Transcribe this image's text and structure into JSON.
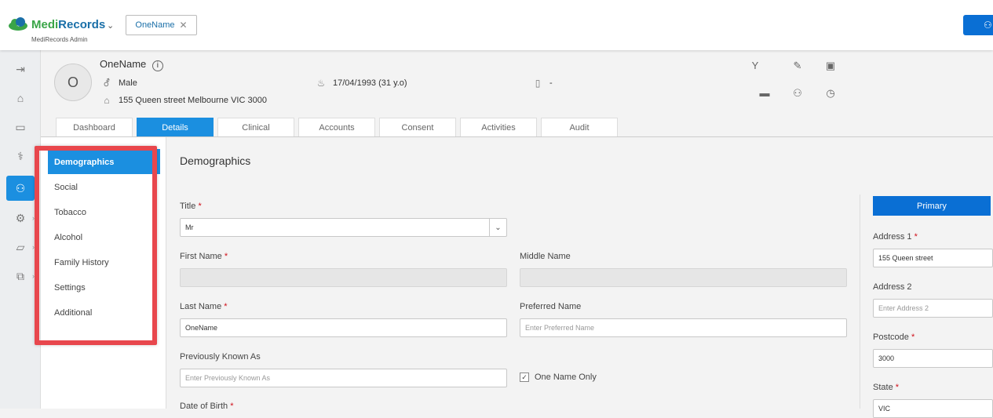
{
  "app": {
    "brand_part1": "Medi",
    "brand_part2": "Records",
    "brand_sub": "MediRecords Admin",
    "open_tab": "OneName"
  },
  "patient": {
    "name": "OneName",
    "avatar_initial": "O",
    "gender": "Male",
    "address": "155 Queen street Melbourne VIC 3000",
    "dob": "17/04/1993 (31 y.o)",
    "phone": "-"
  },
  "tabs": [
    {
      "label": "Dashboard"
    },
    {
      "label": "Details"
    },
    {
      "label": "Clinical"
    },
    {
      "label": "Accounts"
    },
    {
      "label": "Consent"
    },
    {
      "label": "Activities"
    },
    {
      "label": "Audit"
    }
  ],
  "side_menu": [
    {
      "label": "Demographics"
    },
    {
      "label": "Social"
    },
    {
      "label": "Tobacco"
    },
    {
      "label": "Alcohol"
    },
    {
      "label": "Family History"
    },
    {
      "label": "Settings"
    },
    {
      "label": "Additional"
    }
  ],
  "form": {
    "title": "Demographics",
    "title_label": "Title",
    "title_value": "Mr",
    "first_name_label": "First Name",
    "middle_name_label": "Middle Name",
    "last_name_label": "Last Name",
    "last_name_value": "OneName",
    "preferred_name_label": "Preferred Name",
    "preferred_name_placeholder": "Enter Preferred Name",
    "prev_known_label": "Previously Known As",
    "prev_known_placeholder": "Enter Previously Known As",
    "one_name_only_label": "One Name Only",
    "dob_label": "Date of Birth",
    "required_mark": "*"
  },
  "address": {
    "tab_label": "Primary",
    "address1_label": "Address 1",
    "address1_value": "155 Queen street",
    "address2_label": "Address 2",
    "address2_placeholder": "Enter Address 2",
    "postcode_label": "Postcode",
    "postcode_value": "3000",
    "state_label": "State",
    "state_value": "VIC"
  },
  "colors": {
    "accent": "#1b8fe0",
    "primary": "#0a6fd4",
    "highlight": "#e8474d"
  }
}
